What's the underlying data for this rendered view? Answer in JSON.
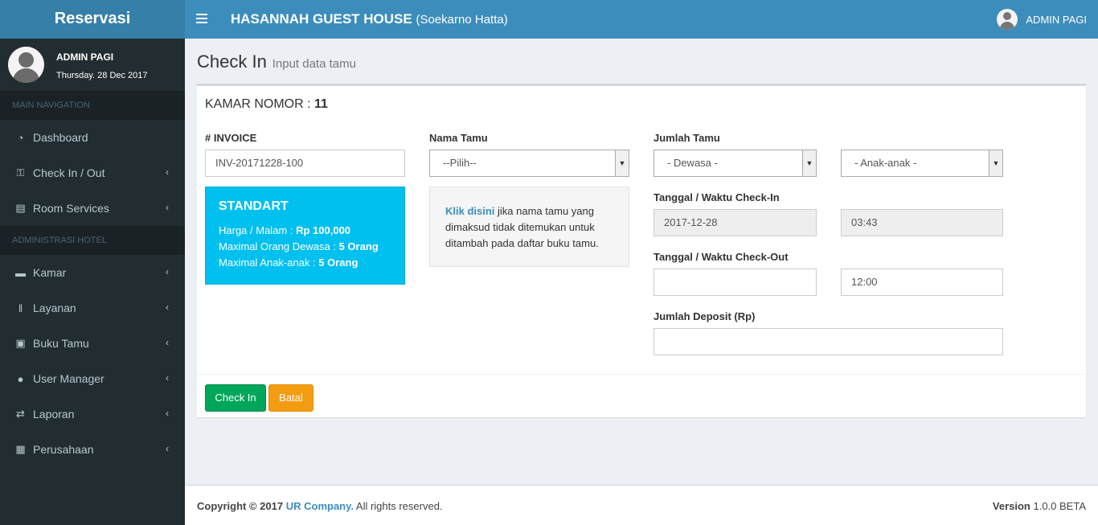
{
  "app": {
    "logo_text": "Reservasi",
    "brand_name": "HASANNAH GUEST HOUSE",
    "brand_location": "(Soekarno Hatta)",
    "header_user": "ADMIN PAGI"
  },
  "sidebar": {
    "user_name": "ADMIN PAGI",
    "user_date": "Thursday. 28 Dec 2017",
    "main_header": "MAIN NAVIGATION",
    "admin_header": "ADMINISTRASI HOTEL",
    "main_items": [
      {
        "label": "Dashboard",
        "icon": "dashboard-icon",
        "has_submenu": false
      },
      {
        "label": "Check In / Out",
        "icon": "key-icon",
        "has_submenu": true
      },
      {
        "label": "Room Services",
        "icon": "book-icon",
        "has_submenu": true
      }
    ],
    "admin_items": [
      {
        "label": "Kamar",
        "icon": "bed-icon",
        "has_submenu": true
      },
      {
        "label": "Layanan",
        "icon": "cutlery-icon",
        "has_submenu": true
      },
      {
        "label": "Buku Tamu",
        "icon": "briefcase-icon",
        "has_submenu": true
      },
      {
        "label": "User Manager",
        "icon": "user-icon",
        "has_submenu": true
      },
      {
        "label": "Laporan",
        "icon": "exchange-icon",
        "has_submenu": true
      },
      {
        "label": "Perusahaan",
        "icon": "building-icon",
        "has_submenu": true
      }
    ]
  },
  "page": {
    "title": "Check In",
    "subtitle": "Input data tamu"
  },
  "form": {
    "room_label": "KAMAR NOMOR :",
    "room_number": "11",
    "invoice_label": "# INVOICE",
    "invoice_value": "INV-20171228-100",
    "guest_name_label": "Nama Tamu",
    "guest_name_selected": "--Pilih--",
    "guest_count_label": "Jumlah Tamu",
    "adults_selected": "- Dewasa -",
    "children_selected": "- Anak-anak -",
    "checkin_label": "Tanggal / Waktu Check-In",
    "checkin_date": "2017-12-28",
    "checkin_time": "03:43",
    "checkout_label": "Tanggal / Waktu Check-Out",
    "checkout_date": "",
    "checkout_time": "12:00",
    "deposit_label": "Jumlah Deposit (Rp)",
    "deposit_value": ""
  },
  "room_info": {
    "type": "STANDART",
    "price_label": "Harga / Malam :",
    "price_value": "Rp 100,000",
    "max_adult_label": "Maximal Orang Dewasa :",
    "max_adult_value": "5 Orang",
    "max_child_label": "Maximal Anak-anak :",
    "max_child_value": "5 Orang"
  },
  "guest_note": {
    "link_text": "Klik disini",
    "text": " jika nama tamu yang dimaksud tidak ditemukan untuk ditambah pada daftar buku tamu."
  },
  "buttons": {
    "checkin": "Check In",
    "cancel": "Batal"
  },
  "footer": {
    "copyright_prefix": "Copyright © 2017",
    "company": "UR Company.",
    "rights": " All rights reserved.",
    "version_label": "Version",
    "version_value": " 1.0.0 BETA"
  },
  "colors": {
    "header": "#3c8dbc",
    "logo": "#367fa9",
    "sidebar": "#222d32",
    "info_box": "#00c0ef",
    "success": "#00a65a",
    "warning": "#f39c12"
  }
}
